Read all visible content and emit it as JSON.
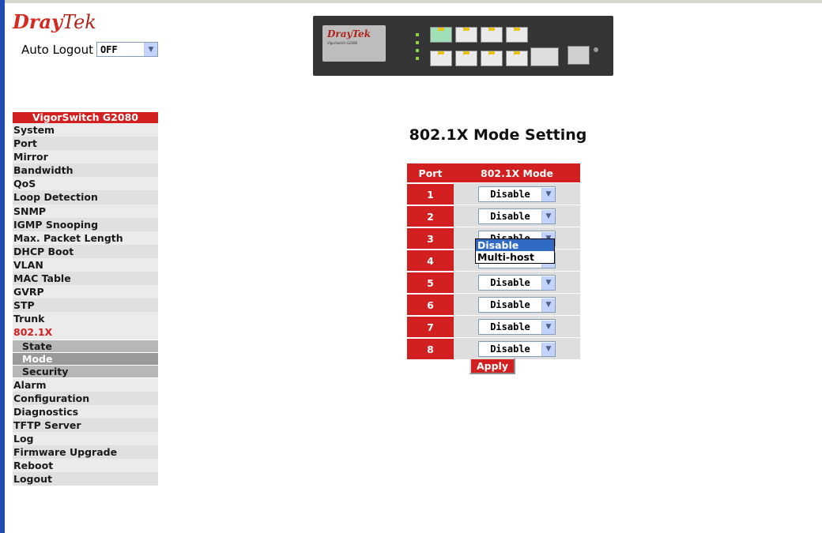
{
  "brand": {
    "dray": "Dray",
    "tek": "Tek"
  },
  "auto_logout": {
    "label": "Auto Logout",
    "value": "OFF"
  },
  "device": {
    "brand_text": "DrayTek",
    "model_text": "VigorSwitch G2080"
  },
  "menu": {
    "header": "VigorSwitch G2080",
    "items_before": [
      "System",
      "Port",
      "Mirror",
      "Bandwidth",
      "QoS",
      "Loop Detection",
      "SNMP",
      "IGMP Snooping",
      "Max. Packet Length",
      "DHCP Boot",
      "VLAN",
      "MAC Table",
      "GVRP",
      "STP",
      "Trunk",
      "802.1X"
    ],
    "submenu": [
      "State",
      "Mode",
      "Security"
    ],
    "items_after": [
      "Alarm",
      "Configuration",
      "Diagnostics",
      "TFTP Server",
      "Log",
      "Firmware Upgrade",
      "Reboot",
      "Logout"
    ]
  },
  "page": {
    "title": "802.1X Mode Setting"
  },
  "table": {
    "col_port": "Port",
    "col_mode": "802.1X Mode",
    "rows": [
      {
        "port": "1",
        "mode": "Disable"
      },
      {
        "port": "2",
        "mode": "Disable"
      },
      {
        "port": "3",
        "mode": "Disable"
      },
      {
        "port": "4",
        "mode": "Disable"
      },
      {
        "port": "5",
        "mode": "Disable"
      },
      {
        "port": "6",
        "mode": "Disable"
      },
      {
        "port": "7",
        "mode": "Disable"
      },
      {
        "port": "8",
        "mode": "Disable"
      }
    ]
  },
  "dropdown_options": [
    "Disable",
    "Multi-host"
  ],
  "apply_label": "Apply",
  "colors": {
    "accent": "#d21f1f",
    "highlight": "#316ac5"
  }
}
